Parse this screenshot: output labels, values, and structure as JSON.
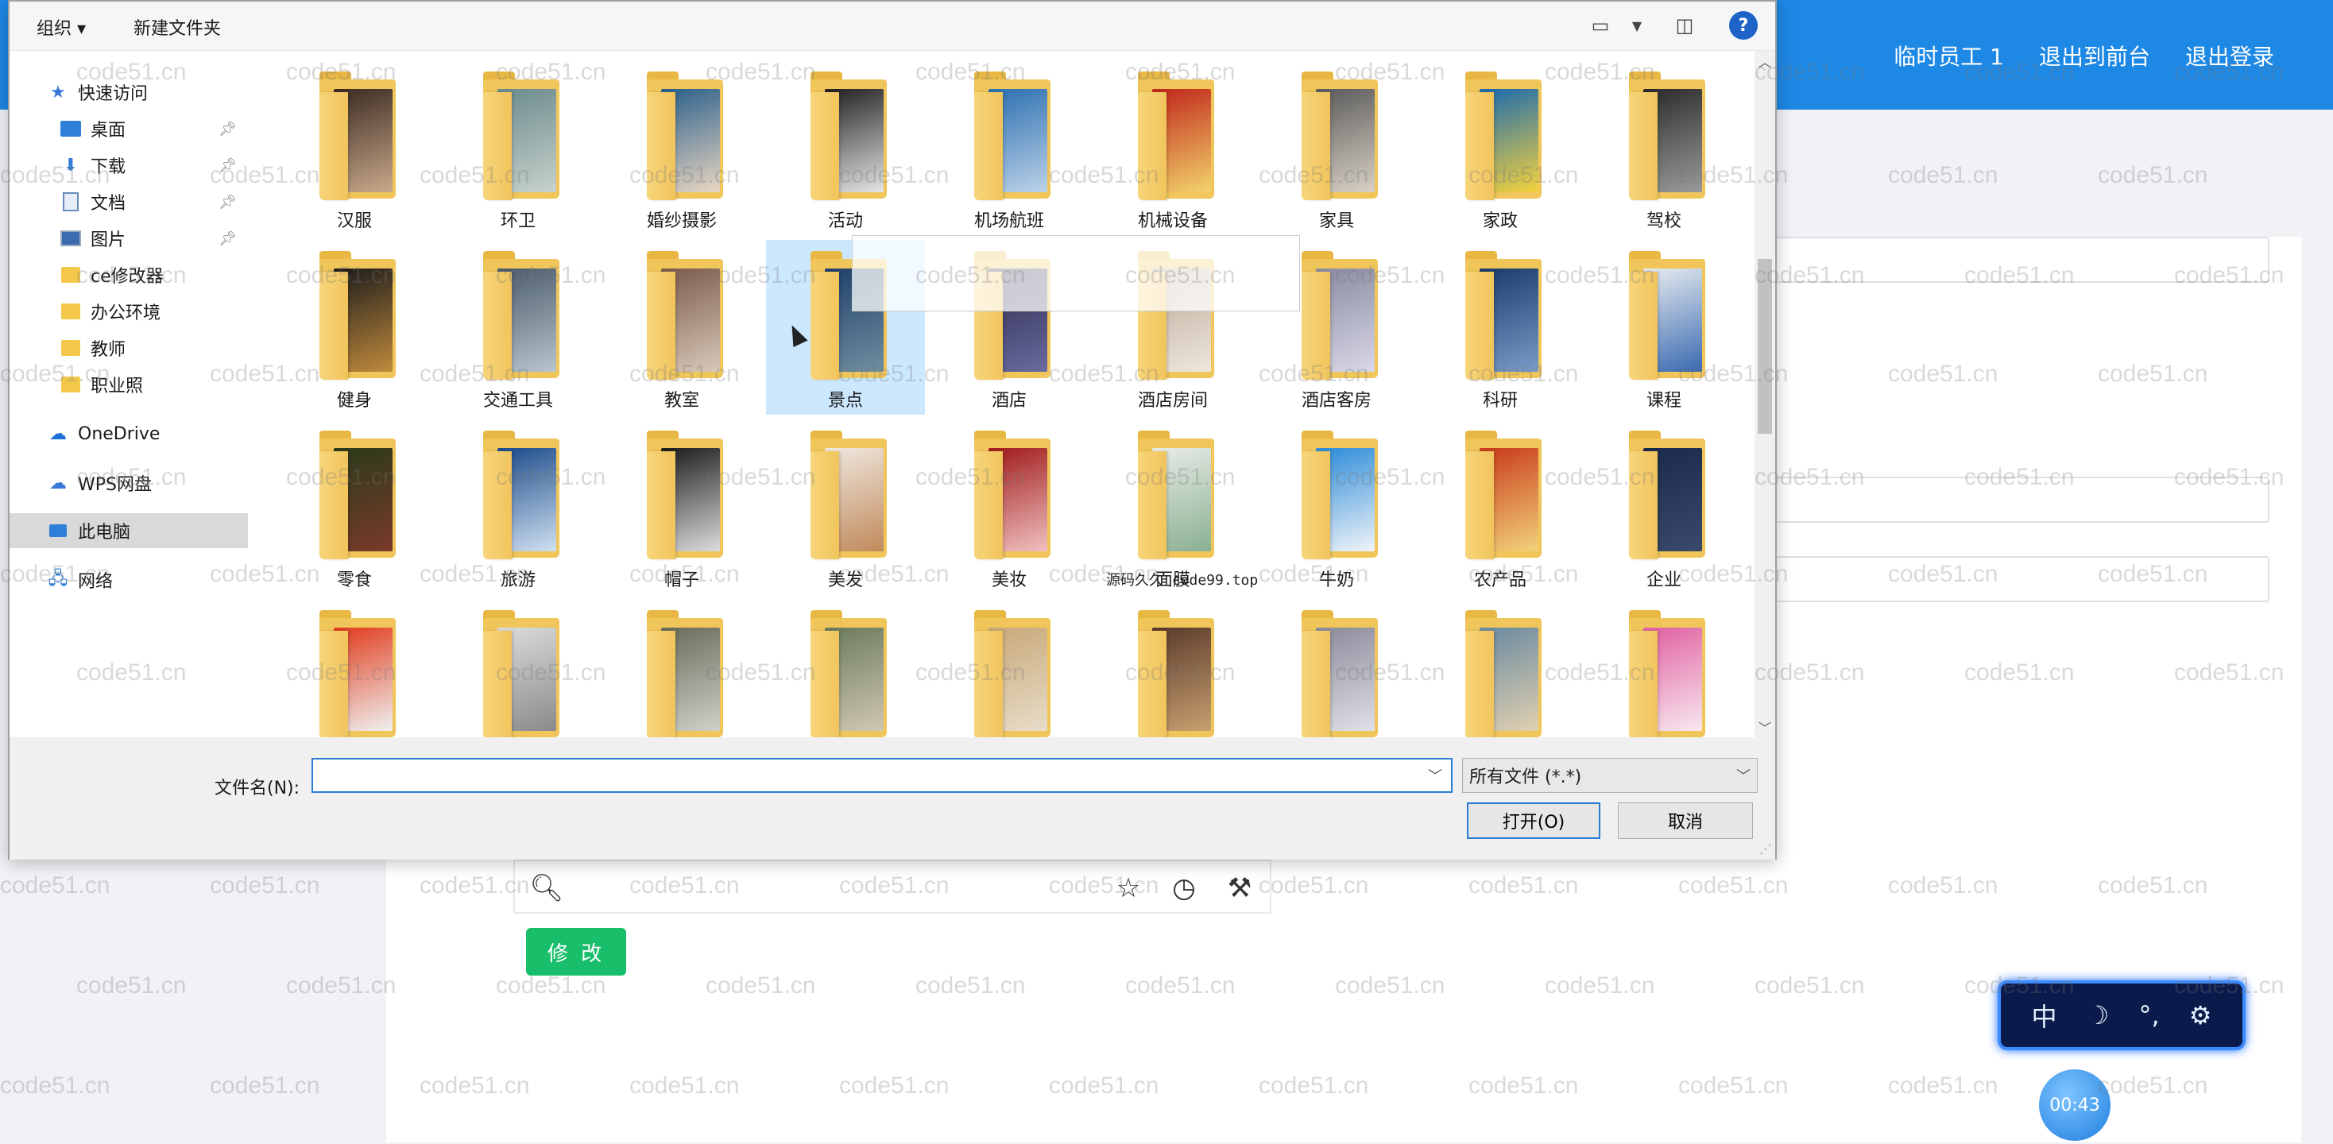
{
  "app_header": {
    "links": [
      "临时员工 1",
      "退出到前台",
      "退出登录"
    ]
  },
  "editor": {
    "modify_label": "修 改"
  },
  "ime": {
    "mode": "中",
    "moon": "☽",
    "punct": "°,",
    "settings": "⚙"
  },
  "timer": {
    "time": "00:43"
  },
  "dialog": {
    "toolbar": {
      "organize": "组织 ▾",
      "new_folder": "新建文件夹",
      "help": "?"
    },
    "nav": {
      "items": [
        {
          "label": "快速访问",
          "icon": "star-icon",
          "pinned": false
        },
        {
          "label": "桌面",
          "icon": "desktop-icon",
          "pinned": true
        },
        {
          "label": "下载",
          "icon": "download-icon",
          "pinned": true
        },
        {
          "label": "文档",
          "icon": "document-icon",
          "pinned": true
        },
        {
          "label": "图片",
          "icon": "picture-icon",
          "pinned": true
        },
        {
          "label": "ce修改器",
          "icon": "folder-icon",
          "pinned": false
        },
        {
          "label": "办公环境",
          "icon": "folder-icon",
          "pinned": false
        },
        {
          "label": "教师",
          "icon": "folder-icon",
          "pinned": false
        },
        {
          "label": "职业照",
          "icon": "folder-icon",
          "pinned": false
        },
        {
          "label": "OneDrive",
          "icon": "cloud-icon",
          "pinned": false
        },
        {
          "label": "WPS网盘",
          "icon": "cloud-icon",
          "pinned": false
        },
        {
          "label": "此电脑",
          "icon": "computer-icon",
          "pinned": false
        },
        {
          "label": "网络",
          "icon": "network-icon",
          "pinned": false
        }
      ]
    },
    "folders": [
      "汉服",
      "环卫",
      "婚纱摄影",
      "活动",
      "机场航班",
      "机械设备",
      "家具",
      "家政",
      "驾校",
      "健身",
      "交通工具",
      "教室",
      "景点",
      "酒店",
      "酒店房间",
      "酒店客房",
      "科研",
      "课程",
      "零食",
      "旅游",
      "帽子",
      "美发",
      "美妆",
      "面膜",
      "牛奶",
      "农产品",
      "企业",
      "",
      "",
      "",
      "",
      "",
      "",
      "",
      "",
      ""
    ],
    "selected_folder": "景点",
    "overlay_text": "源码久久 code99.top",
    "filename_label": "文件名(N):",
    "filename_value": "",
    "filetype": "所有文件 (*.*)",
    "open_label": "打开(O)",
    "cancel_label": "取消"
  },
  "colors": {
    "header_blue": "#1e88e5",
    "folder_yellow": "#f0c65a",
    "accent_green": "#19be6b",
    "selection_blue": "#cce8ff"
  },
  "watermark": "code51.cn"
}
